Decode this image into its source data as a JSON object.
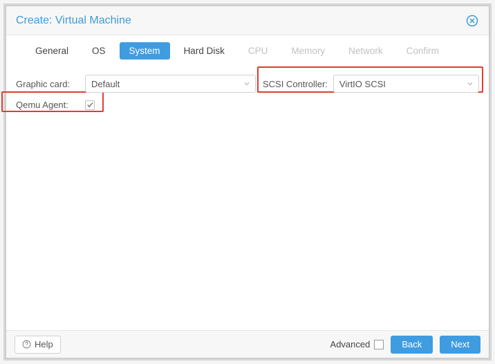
{
  "dialog": {
    "title": "Create: Virtual Machine"
  },
  "tabs": {
    "general": "General",
    "os": "OS",
    "system": "System",
    "harddisk": "Hard Disk",
    "cpu": "CPU",
    "memory": "Memory",
    "network": "Network",
    "confirm": "Confirm"
  },
  "fields": {
    "graphic_card_label": "Graphic card:",
    "graphic_card_value": "Default",
    "scsi_label": "SCSI Controller:",
    "scsi_value": "VirtIO SCSI",
    "qemu_agent_label": "Qemu Agent:",
    "qemu_agent_checked": true
  },
  "footer": {
    "help": "Help",
    "advanced": "Advanced",
    "back": "Back",
    "next": "Next"
  }
}
